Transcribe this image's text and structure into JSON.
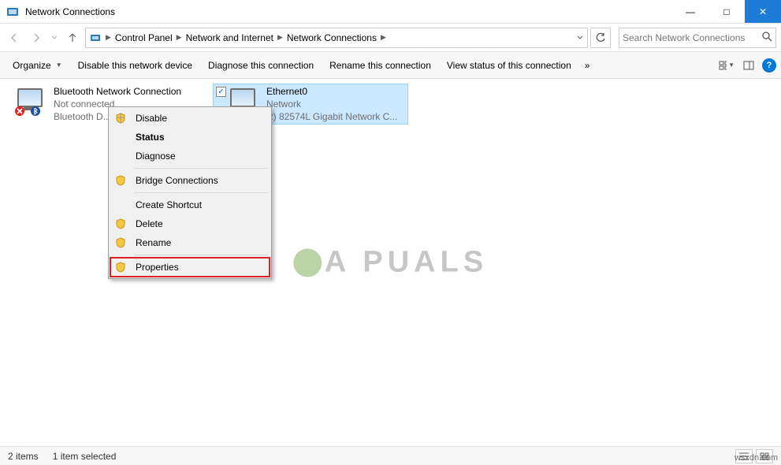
{
  "window": {
    "title": "Network Connections"
  },
  "titlebar_buttons": {
    "min": "—",
    "max": "□",
    "close": "✕"
  },
  "breadcrumbs": {
    "items": [
      "Control Panel",
      "Network and Internet",
      "Network Connections"
    ]
  },
  "search": {
    "placeholder": "Search Network Connections"
  },
  "commandbar": {
    "organize": "Organize",
    "disable": "Disable this network device",
    "diagnose": "Diagnose this connection",
    "rename": "Rename this connection",
    "viewstatus": "View status of this connection",
    "overflow": "»"
  },
  "connections": [
    {
      "name": "Bluetooth Network Connection",
      "status": "Not connected",
      "device": "Bluetooth D...",
      "selected": false,
      "error": true,
      "bt": true
    },
    {
      "name": "Ethernet0",
      "status": "Network",
      "device": "R) 82574L Gigabit Network C...",
      "selected": true,
      "error": false,
      "bt": false
    }
  ],
  "context_menu": {
    "disable": "Disable",
    "status": "Status",
    "diagnose": "Diagnose",
    "bridge": "Bridge Connections",
    "shortcut": "Create Shortcut",
    "delete": "Delete",
    "rename": "Rename",
    "properties": "Properties"
  },
  "statusbar": {
    "count": "2 items",
    "selected": "1 item selected"
  },
  "watermark": "A  PUALS",
  "site": "wsxdn.com"
}
